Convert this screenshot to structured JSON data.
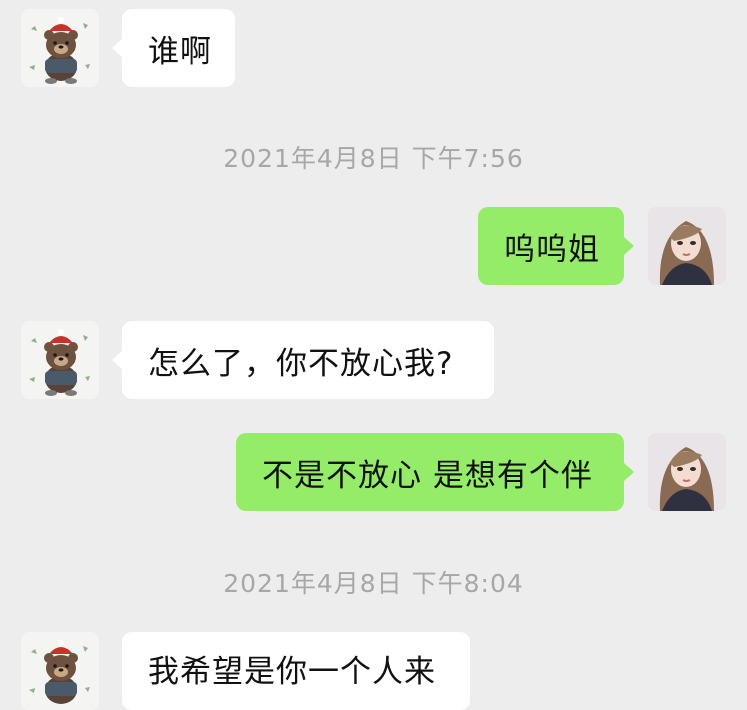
{
  "messages": [
    {
      "type": "message",
      "from": "them",
      "text": "谁啊"
    },
    {
      "type": "timestamp",
      "text": "2021年4月8日 下午7:56"
    },
    {
      "type": "message",
      "from": "me",
      "text": "呜呜姐"
    },
    {
      "type": "message",
      "from": "them",
      "text": "怎么了，你不放心我?"
    },
    {
      "type": "message",
      "from": "me",
      "text": "不是不放心 是想有个伴"
    },
    {
      "type": "timestamp",
      "text": "2021年4月8日 下午8:04"
    },
    {
      "type": "message",
      "from": "them",
      "text": "我希望是你一个人来"
    }
  ],
  "colors": {
    "background": "#ededed",
    "incoming_bubble": "#ffffff",
    "outgoing_bubble": "#95ec69",
    "timestamp_text": "#a7a7a7"
  },
  "avatars": {
    "them": "brown-bear-avatar-icon",
    "me": "girl-portrait-avatar-icon"
  }
}
